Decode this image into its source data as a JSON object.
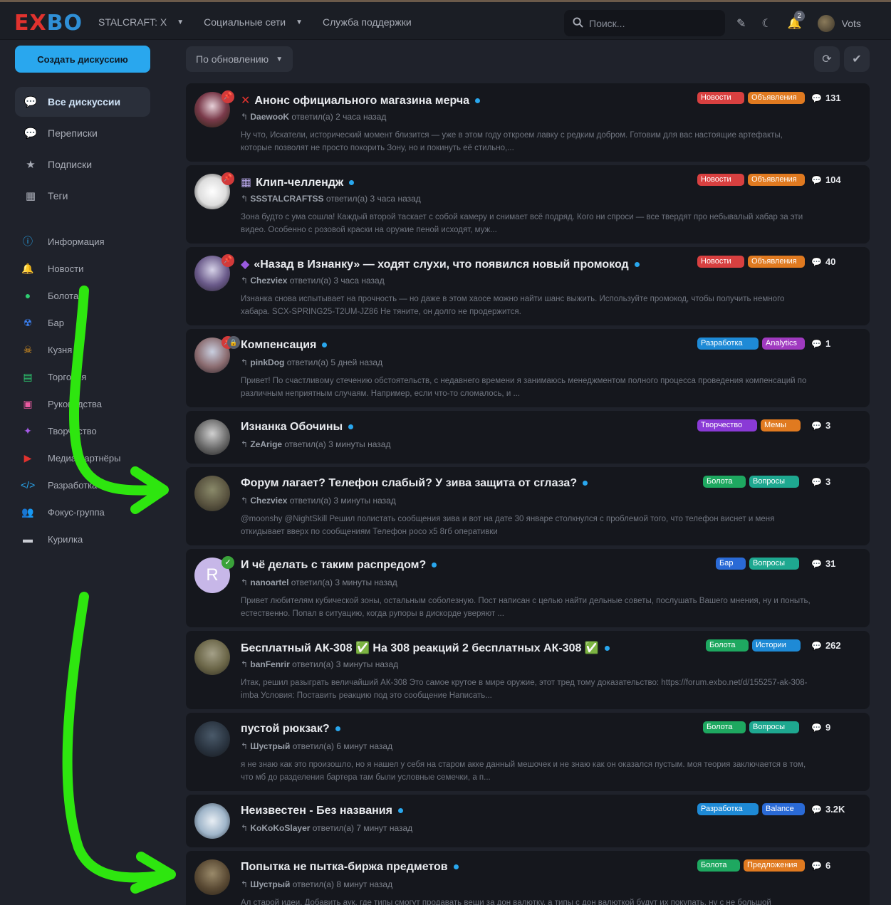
{
  "header": {
    "logo_ex": "EX",
    "logo_bo": "BO",
    "nav": [
      {
        "label": "STALCRAFT: X",
        "has_caret": true
      },
      {
        "label": "Социальные сети",
        "has_caret": true
      },
      {
        "label": "Служба поддержки",
        "has_caret": false
      }
    ],
    "search_placeholder": "Поиск...",
    "notification_count": "2",
    "username": "Vots"
  },
  "sidebar": {
    "create_label": "Создать дискуссию",
    "items": [
      {
        "label": "Все дискуссии",
        "icon": "chat-bubbles-icon",
        "active": true
      },
      {
        "label": "Переписки",
        "icon": "chat-icon",
        "active": false
      },
      {
        "label": "Подписки",
        "icon": "star-icon",
        "active": false
      },
      {
        "label": "Теги",
        "icon": "grid-icon",
        "active": false
      }
    ],
    "tags": [
      {
        "label": "Информация",
        "icon": "info-icon",
        "color": "#29a7ee"
      },
      {
        "label": "Новости",
        "icon": "bell-icon",
        "color": "#e0322e"
      },
      {
        "label": "Болота",
        "icon": "frog-icon",
        "color": "#2ecc71"
      },
      {
        "label": "Бар",
        "icon": "radiation-icon",
        "color": "#3b82f6"
      },
      {
        "label": "Кузня",
        "icon": "skull-icon",
        "color": "#f0a020"
      },
      {
        "label": "Торговля",
        "icon": "shop-icon",
        "color": "#2ecc71"
      },
      {
        "label": "Руководства",
        "icon": "book-icon",
        "color": "#e85aa0"
      },
      {
        "label": "Творчество",
        "icon": "wand-icon",
        "color": "#a65ae8"
      },
      {
        "label": "Медиа-партнёры",
        "icon": "youtube-icon",
        "color": "#e0322e"
      },
      {
        "label": "Разработка",
        "icon": "code-icon",
        "color": "#29a7ee"
      },
      {
        "label": "Фокус-группа",
        "icon": "users-icon",
        "color": "#f0a020"
      },
      {
        "label": "Курилка",
        "icon": "cigarette-icon",
        "color": "#c9ccd3"
      }
    ]
  },
  "toolbar": {
    "sort_label": "По обновлению"
  },
  "discussions": [
    {
      "title": "Анонс официального магазина мерча",
      "emoji": "✕",
      "emoji_color": "#e0322e",
      "user": "DaewooK",
      "action": "ответил(а)",
      "time": "2 часа назад",
      "excerpt": "Ну что, Искатели, исторический момент близится — уже в этом году откроем лавку с редким добром. Готовим для вас настоящие артефакты, которые позволят не просто покорить Зону, но и покинуть её стильно,...",
      "replies": "131",
      "pinned": true,
      "tags": [
        {
          "label": "Новости",
          "color": "#d84040"
        },
        {
          "label": "Объявления",
          "color": "#e07a20"
        }
      ]
    },
    {
      "title": "Клип-челлендж",
      "emoji": "▦",
      "emoji_color": "#b0a0e0",
      "user": "SSSTALCRAFTSS",
      "action": "ответил(а)",
      "time": "3 часа назад",
      "excerpt": "Зона будто с ума сошла! Каждый второй таскает с собой камеру и снимает всё подряд. Кого ни спроси — все твердят про небывалый хабар за эти видео. Особенно с розовой краски на оружие пеной исходят, муж...",
      "replies": "104",
      "pinned": true,
      "tags": [
        {
          "label": "Новости",
          "color": "#d84040"
        },
        {
          "label": "Объявления",
          "color": "#e07a20"
        }
      ]
    },
    {
      "title": "«Назад в Изнанку» — ходят слухи, что появился новый промокод",
      "emoji": "◆",
      "emoji_color": "#9a5ae0",
      "user": "Chezviex",
      "action": "ответил(а)",
      "time": "3 часа назад",
      "excerpt": "Изнанка снова испытывает на прочность — но даже в этом хаосе можно найти шанс выжить. Используйте промокод, чтобы получить немного хабара. SCX-SPRING25-T2UM-JZ86 Не тяните, он долго не продержится.",
      "replies": "40",
      "pinned": true,
      "tags": [
        {
          "label": "Новости",
          "color": "#d84040"
        },
        {
          "label": "Объявления",
          "color": "#e07a20"
        }
      ]
    },
    {
      "title": "Компенсация",
      "emoji": "",
      "emoji_color": "",
      "user": "pinkDog",
      "action": "ответил(а)",
      "time": "5 дней назад",
      "excerpt": "Привет! По счастливому стечению обстоятельств, с недавнего времени я занимаюсь менеджментом полного процесса проведения компенсаций по различным неприятным случаям. Например, если что-то сломалось, и ...",
      "replies": "1",
      "pinned": true,
      "locked": true,
      "tags": [
        {
          "label": "Разработка",
          "color": "#1e8ad6"
        },
        {
          "label": "Analytics",
          "color": "#a03ac0"
        }
      ]
    },
    {
      "title": "Изнанка Обочины",
      "emoji": "",
      "emoji_color": "",
      "user": "ZeArige",
      "action": "ответил(а)",
      "time": "3 минуты назад",
      "excerpt": "",
      "replies": "3",
      "tags": [
        {
          "label": "Творчество",
          "color": "#8a3ad6"
        },
        {
          "label": "Мемы",
          "color": "#e07a20"
        }
      ]
    },
    {
      "title": "Форум лагает? Телефон слабый? У зива защита от сглаза?",
      "emoji": "",
      "emoji_color": "",
      "user": "Chezviex",
      "action": "ответил(а)",
      "time": "3 минуты назад",
      "excerpt": "@moonshy @NightSkill Решил полистать сообщения зива и вот на дате 30 январе столкнулся с проблемой того, что телефон виснет и меня откидывает вверх по сообщениям Телефон poco x5 8гб оперативки",
      "replies": "3",
      "tags": [
        {
          "label": "Болота",
          "color": "#1ea860"
        },
        {
          "label": "Вопросы",
          "color": "#1ea890"
        }
      ]
    },
    {
      "title": "И чё делать с таким распредом?",
      "emoji": "",
      "emoji_color": "",
      "user": "nanoartel",
      "action": "ответил(а)",
      "time": "3 минуты назад",
      "excerpt": "Привет любителям кубической зоны, остальным соболезную. Пост написан с целью найти дельные советы, послушать Вашего мнения, ну и поныть, естественно. Попал в ситуацию, когда рупоры в дискорде уверяют ...",
      "replies": "31",
      "verified": true,
      "tags": [
        {
          "label": "Бар",
          "color": "#2a6ad6"
        },
        {
          "label": "Вопросы",
          "color": "#1ea890"
        }
      ]
    },
    {
      "title": "Бесплатный АК-308 ✅ На 308 реакций 2 бесплатных АК-308 ✅",
      "emoji": "",
      "emoji_color": "",
      "user": "banFenrir",
      "action": "ответил(а)",
      "time": "3 минуты назад",
      "excerpt": "Итак, решил разыграть величайший АК-308 Это самое крутое в мире оружие, этот тред тому доказательство: https://forum.exbo.net/d/155257-ak-308-imba Условия: Поставить реакцию под это сообщение Написать...",
      "replies": "262",
      "tags": [
        {
          "label": "Болота",
          "color": "#1ea860"
        },
        {
          "label": "Истории",
          "color": "#1e8ad6"
        }
      ]
    },
    {
      "title": "пустой рюкзак?",
      "emoji": "",
      "emoji_color": "",
      "user": "Шустрый",
      "action": "ответил(а)",
      "time": "6 минут назад",
      "excerpt": "я не знаю как это произошло, но я нашел у себя на старом акке данный мешочек и не знаю как он оказался пустым. моя теория заключается в том, что мб до разделения бартера там были условные семечки, а п...",
      "replies": "9",
      "tags": [
        {
          "label": "Болота",
          "color": "#1ea860"
        },
        {
          "label": "Вопросы",
          "color": "#1ea890"
        }
      ]
    },
    {
      "title": "Неизвестен - Без названия",
      "emoji": "",
      "emoji_color": "",
      "user": "KoKoKoSlayer",
      "action": "ответил(а)",
      "time": "7 минут назад",
      "excerpt": "",
      "replies": "3.2K",
      "tags": [
        {
          "label": "Разработка",
          "color": "#1e8ad6"
        },
        {
          "label": "Balance",
          "color": "#2a6ad6"
        }
      ]
    },
    {
      "title": "Попытка не пытка-биржа предметов",
      "emoji": "",
      "emoji_color": "",
      "user": "Шустрый",
      "action": "ответил(а)",
      "time": "8 минут назад",
      "excerpt": "Ал старой идеи. Добавить аук, где типы смогут продавать вещи за дон валютку, а типы с дон валюткой будут их покупать, ну с не большой",
      "replies": "6",
      "tags": [
        {
          "label": "Болота",
          "color": "#1ea860"
        },
        {
          "label": "Предложения",
          "color": "#e07a20"
        }
      ]
    }
  ]
}
